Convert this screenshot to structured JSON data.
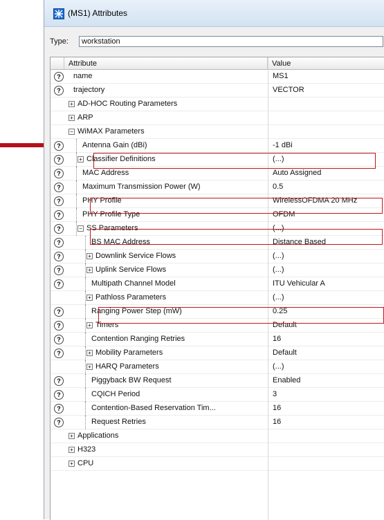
{
  "window": {
    "title": "(MS1) Attributes"
  },
  "type_field": {
    "label": "Type:",
    "value": "workstation"
  },
  "table": {
    "headers": {
      "attribute": "Attribute",
      "value": "Value"
    },
    "rows": [
      {
        "icon": true,
        "indent": 0,
        "exp": "",
        "attr": "name",
        "value": "MS1"
      },
      {
        "icon": true,
        "indent": 0,
        "exp": "",
        "attr": "trajectory",
        "value": "VECTOR"
      },
      {
        "icon": false,
        "indent": 0,
        "exp": "+",
        "attr": "AD-HOC Routing Parameters",
        "value": ""
      },
      {
        "icon": false,
        "indent": 0,
        "exp": "+",
        "attr": "ARP",
        "value": ""
      },
      {
        "icon": false,
        "indent": 0,
        "exp": "−",
        "attr": "WiMAX Parameters",
        "value": ""
      },
      {
        "icon": true,
        "indent": 1,
        "exp": "",
        "attr": "Antenna Gain (dBi)",
        "value": "-1 dBi"
      },
      {
        "icon": true,
        "indent": 1,
        "exp": "+",
        "attr": "Classifier Definitions",
        "value": "(...)"
      },
      {
        "icon": true,
        "indent": 1,
        "exp": "",
        "attr": "MAC Address",
        "value": "Auto Assigned"
      },
      {
        "icon": true,
        "indent": 1,
        "exp": "",
        "attr": "Maximum Transmission Power (W)",
        "value": "0.5"
      },
      {
        "icon": true,
        "indent": 1,
        "exp": "",
        "attr": "PHY Profile",
        "value": "WirelessOFDMA 20 MHz"
      },
      {
        "icon": true,
        "indent": 1,
        "exp": "",
        "attr": "PHY Profile Type",
        "value": "OFDM"
      },
      {
        "icon": true,
        "indent": 1,
        "exp": "−",
        "attr": "SS Parameters",
        "value": "(...)"
      },
      {
        "icon": true,
        "indent": 2,
        "exp": "",
        "attr": "BS MAC Address",
        "value": "Distance Based"
      },
      {
        "icon": true,
        "indent": 2,
        "exp": "+",
        "attr": "Downlink Service Flows",
        "value": "(...)"
      },
      {
        "icon": true,
        "indent": 2,
        "exp": "+",
        "attr": "Uplink Service Flows",
        "value": "(...)"
      },
      {
        "icon": true,
        "indent": 2,
        "exp": "",
        "attr": "Multipath Channel Model",
        "value": "ITU Vehicular A"
      },
      {
        "icon": false,
        "indent": 2,
        "exp": "+",
        "attr": "Pathloss Parameters",
        "value": "(...)"
      },
      {
        "icon": true,
        "indent": 2,
        "exp": "",
        "attr": "Ranging Power Step (mW)",
        "value": "0.25"
      },
      {
        "icon": true,
        "indent": 2,
        "exp": "+",
        "attr": "Timers",
        "value": "Default"
      },
      {
        "icon": true,
        "indent": 2,
        "exp": "",
        "attr": "Contention Ranging Retries",
        "value": "16"
      },
      {
        "icon": true,
        "indent": 2,
        "exp": "+",
        "attr": "Mobility Parameters",
        "value": "Default"
      },
      {
        "icon": false,
        "indent": 2,
        "exp": "+",
        "attr": "HARQ Parameters",
        "value": "(...)"
      },
      {
        "icon": true,
        "indent": 2,
        "exp": "",
        "attr": "Piggyback BW Request",
        "value": "Enabled"
      },
      {
        "icon": true,
        "indent": 2,
        "exp": "",
        "attr": "CQICH Period",
        "value": "3"
      },
      {
        "icon": true,
        "indent": 2,
        "exp": "",
        "attr": "Contention-Based Reservation Tim...",
        "value": "16"
      },
      {
        "icon": true,
        "indent": 2,
        "exp": "",
        "attr": "Request Retries",
        "value": "16"
      },
      {
        "icon": false,
        "indent": 0,
        "exp": "+",
        "attr": "Applications",
        "value": ""
      },
      {
        "icon": false,
        "indent": 0,
        "exp": "+",
        "attr": "H323",
        "value": ""
      },
      {
        "icon": false,
        "indent": 0,
        "exp": "+",
        "attr": "CPU",
        "value": ""
      }
    ]
  },
  "colors": {
    "highlight": "#c0161d",
    "arrow": "#b3121a"
  }
}
